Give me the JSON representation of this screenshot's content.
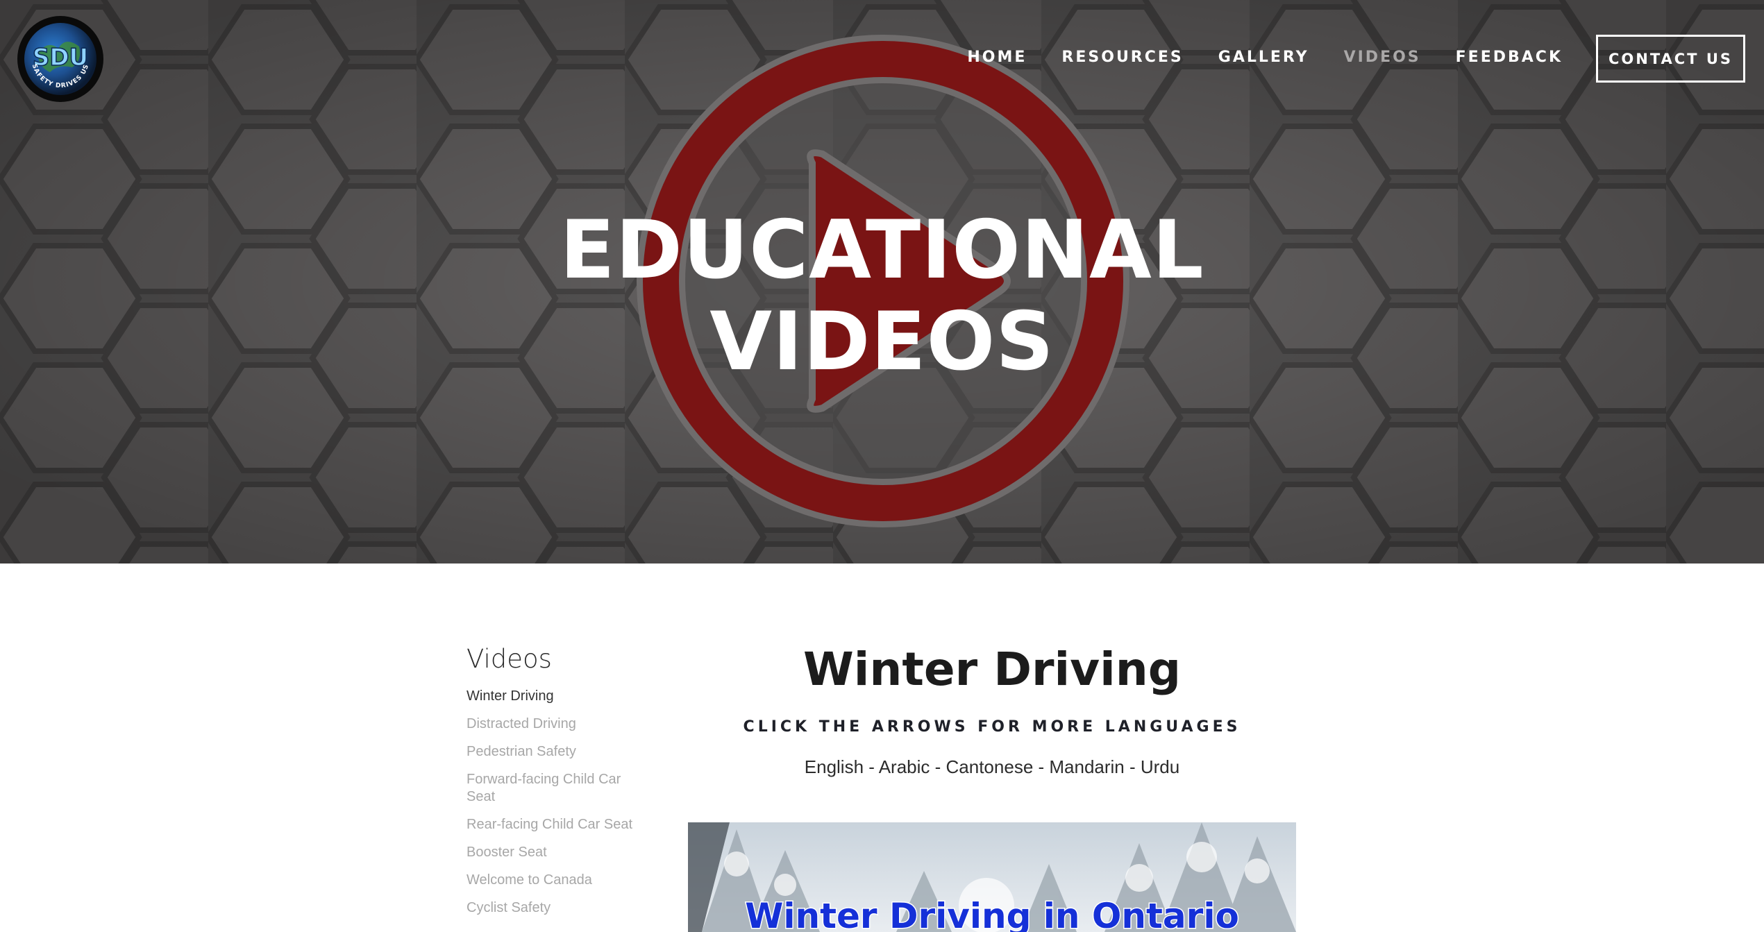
{
  "logo": {
    "initials": "SDU",
    "ring_text": "SAFETY DRIVES US"
  },
  "nav": {
    "items": [
      {
        "label": "HOME",
        "active": false
      },
      {
        "label": "RESOURCES",
        "active": false
      },
      {
        "label": "GALLERY",
        "active": false
      },
      {
        "label": "VIDEOS",
        "active": true
      },
      {
        "label": "FEEDBACK",
        "active": false
      }
    ],
    "contact_label": "CONTACT US"
  },
  "hero": {
    "title_line1": "EDUCATIONAL",
    "title_line2": "VIDEOS"
  },
  "sidebar": {
    "title": "Videos",
    "items": [
      {
        "label": "Winter Driving",
        "current": true
      },
      {
        "label": "Distracted Driving",
        "current": false
      },
      {
        "label": "Pedestrian Safety",
        "current": false
      },
      {
        "label": "Forward-facing Child Car Seat",
        "current": false
      },
      {
        "label": "Rear-facing Child Car Seat",
        "current": false
      },
      {
        "label": "Booster Seat",
        "current": false
      },
      {
        "label": "Welcome to Canada",
        "current": false
      },
      {
        "label": "Cyclist Safety",
        "current": false
      }
    ]
  },
  "main": {
    "title": "Winter Driving",
    "subtitle": "CLICK THE ARROWS FOR MORE LANGUAGES",
    "languages": "English - Arabic - Cantonese - Mandarin - Urdu",
    "video_caption": "Winter Driving in Ontario"
  },
  "colors": {
    "hero_overlay": "#555353",
    "play_red": "#7a1414",
    "nav_active": "#aaa8a8",
    "caption_blue": "#1530d8"
  }
}
